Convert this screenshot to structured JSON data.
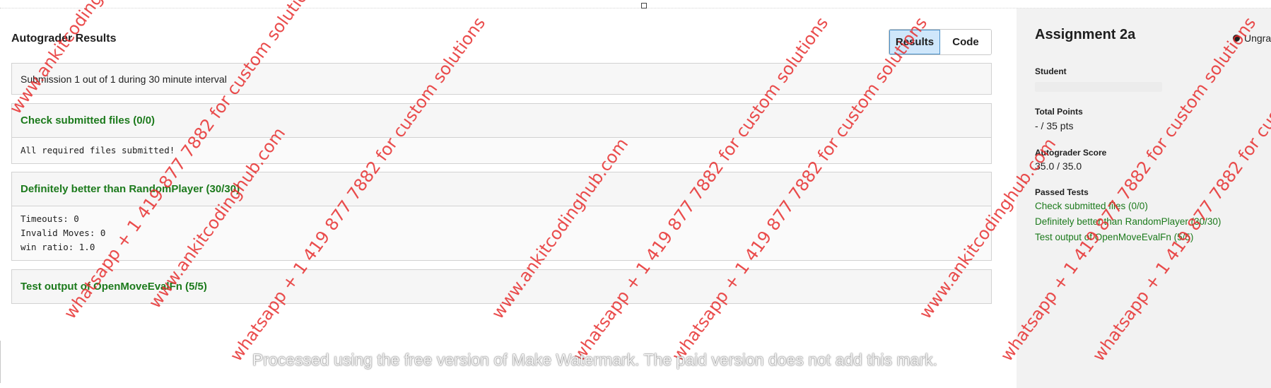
{
  "autograder": {
    "title": "Autograder Results",
    "toggle": {
      "results": "Results",
      "code": "Code"
    },
    "summary": "Submission 1 out of 1 during 30 minute interval",
    "tests": [
      {
        "name": "Check submitted files (0/0)",
        "output": "All required files submitted!"
      },
      {
        "name": "Definitely better than RandomPlayer (30/30)",
        "output": "Timeouts: 0\nInvalid Moves: 0\nwin ratio: 1.0"
      },
      {
        "name": "Test output of OpenMoveEvalFn (5/5)",
        "output": ""
      }
    ]
  },
  "sidebar": {
    "title": "Assignment 2a",
    "status": "Ungraded",
    "student_label": "Student",
    "total_points_label": "Total Points",
    "total_points_value": "- / 35 pts",
    "autograder_score_label": "Autograder Score",
    "autograder_score_value": "35.0 / 35.0",
    "passed_tests_label": "Passed Tests",
    "passed_tests": [
      "Check submitted files (0/0)",
      "Definitely better than RandomPlayer (30/30)",
      "Test output of OpenMoveEvalFn (5/5)"
    ]
  },
  "watermarks": {
    "line1": "www.ankitcodinghub.com",
    "line2": "whatsapp + 1 419 877 7882 for custom solutions",
    "line3": "www.ankitcodinghub.com",
    "line4": "whatsapp + 1 419 877 7882 for custom solutions",
    "line5": "www.ankitcodinghub.com",
    "line6": "whatsapp + 1 419 877 7882 for custom solutions",
    "footer": "Processed using the free version of Make Watermark. The paid version does not add this mark."
  },
  "colors": {
    "pass_green": "#1c7a1c",
    "watermark_red": "#e62d2d",
    "active_toggle": "#cfe7fb"
  }
}
